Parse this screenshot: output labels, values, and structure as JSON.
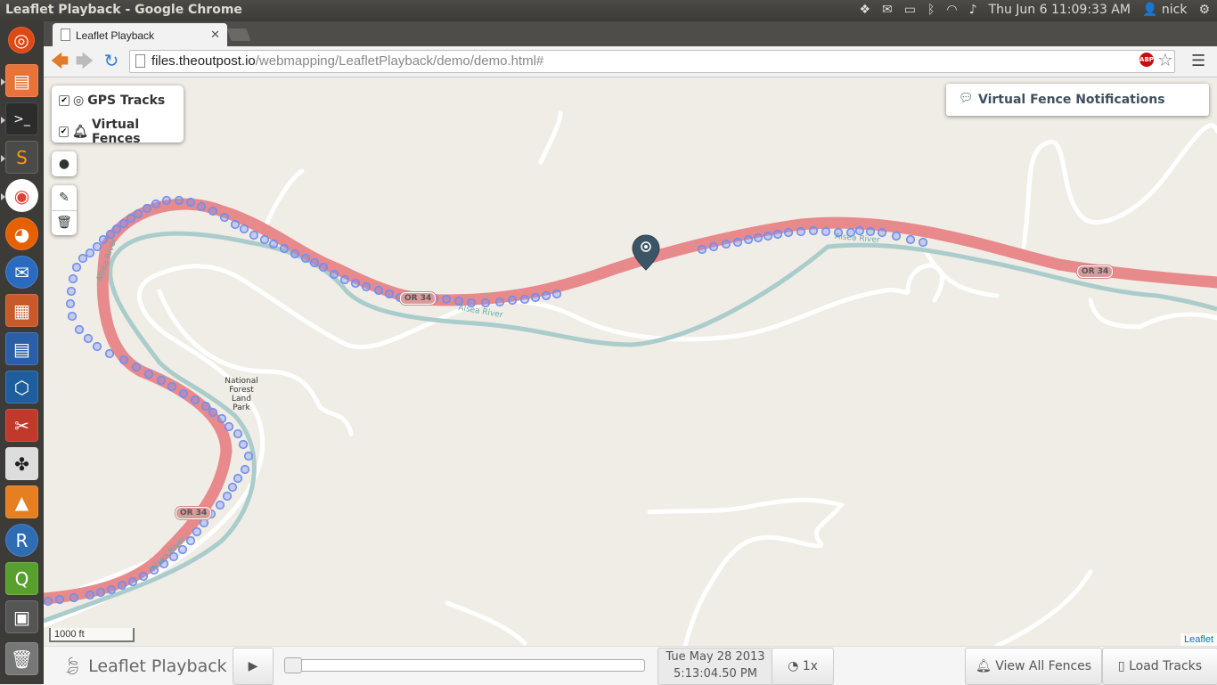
{
  "panel": {
    "window_title": "Leaflet Playback - Google Chrome",
    "clock": "Thu Jun 6 11:09:33 AM",
    "user": "nick"
  },
  "launcher": {
    "items": [
      "dash-icon",
      "files-icon",
      "terminal-icon",
      "sublime-icon",
      "chrome-icon",
      "firefox-icon",
      "thunderbird-icon",
      "impress-icon",
      "writer-icon",
      "virtualbox-icon",
      "settings-icon",
      "windmill-icon",
      "vlc-icon",
      "r-icon",
      "qgis-icon",
      "workspace-icon",
      "trash-icon"
    ]
  },
  "browser": {
    "tab_title": "Leaflet Playback",
    "url_host": "files.theoutpost.io",
    "url_path": "/webmapping/LeafletPlayback/demo/demo.html#",
    "abp_label": "ABP"
  },
  "map": {
    "layers": [
      {
        "label": "GPS Tracks",
        "checked": true
      },
      {
        "label": "Virtual Fences",
        "checked": true
      }
    ],
    "notifications_label": "Virtual Fence Notifications",
    "scale_label": "1000 ft",
    "attribution": "Leaflet",
    "place_label": "National Forest Land Park",
    "route_shields": [
      "OR 34",
      "OR 34",
      "OR 34"
    ],
    "river_labels": [
      "Alsea River",
      "Alsea River",
      "Alsea River",
      "Alsea River"
    ],
    "colors": {
      "track": "#e8898b",
      "river": "#aacccb",
      "points": "#6f8ff0",
      "marker": "#3b5566"
    }
  },
  "playback": {
    "brand": "Leaflet Playback",
    "date": "Tue May 28 2013",
    "time": "5:13:04.50 PM",
    "speed": "1x",
    "progress_fraction": 0.0,
    "view_fences_label": "View All Fences",
    "load_tracks_label": "Load Tracks"
  }
}
